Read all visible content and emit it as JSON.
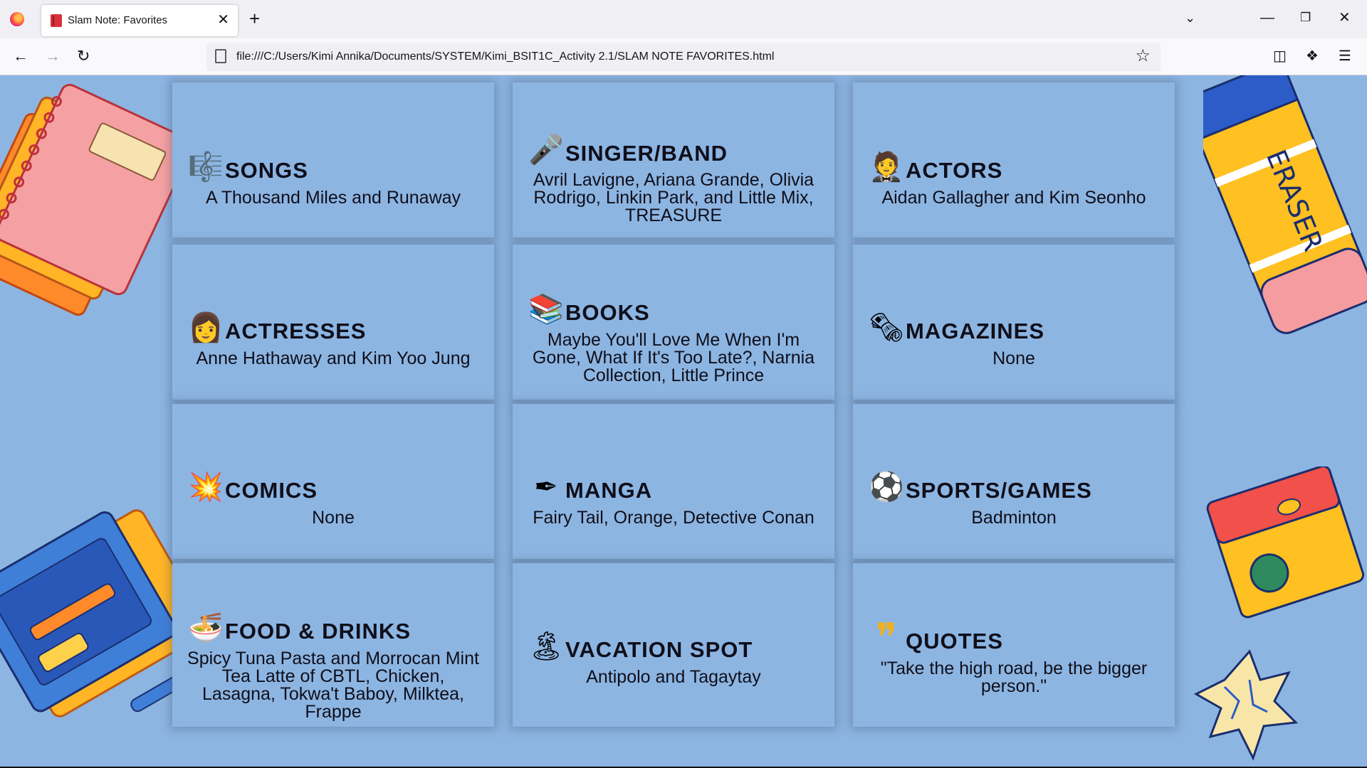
{
  "browser": {
    "tab_title": "Slam Note: Favorites",
    "tab_close": "✕",
    "new_tab": "+",
    "url": "file:///C:/Users/Kimi Annika/Documents/SYSTEM/Kimi_BSIT1C_Activity 2.1/SLAM NOTE FAVORITES.html"
  },
  "cards": [
    {
      "title": "SONGS",
      "body": "A Thousand Miles and Runaway",
      "icon": "music-notes-icon",
      "glyph": "🎼"
    },
    {
      "title": "SINGER/BAND",
      "body": "Avril Lavigne, Ariana Grande, Olivia Rodrigo, Linkin Park, and Little Mix, TREASURE",
      "icon": "microphone-icon",
      "glyph": "🎤"
    },
    {
      "title": "ACTORS",
      "body": "Aidan Gallagher and Kim Seonho",
      "icon": "man-in-suit-icon",
      "glyph": "🤵"
    },
    {
      "title": "ACTRESSES",
      "body": "Anne Hathaway and Kim Yoo Jung",
      "icon": "woman-icon",
      "glyph": "👩"
    },
    {
      "title": "BOOKS",
      "body": "Maybe You'll Love Me When I'm Gone, What If It's Too Late?, Narnia Collection, Little Prince",
      "icon": "books-icon",
      "glyph": "📚"
    },
    {
      "title": "MAGAZINES",
      "body": "None",
      "icon": "newspaper-stack-icon",
      "glyph": "🗞"
    },
    {
      "title": "COMICS",
      "body": "None",
      "icon": "comic-burst-icon",
      "glyph": "💥"
    },
    {
      "title": "MANGA",
      "body": "Fairy Tail, Orange, Detective Conan",
      "icon": "pen-sketch-icon",
      "glyph": "✒"
    },
    {
      "title": "SPORTS/GAMES",
      "body": "Badminton",
      "icon": "sports-ball-icon",
      "glyph": "⚽"
    },
    {
      "title": "FOOD & DRINKS",
      "body": "Spicy Tuna Pasta and Morrocan Mint Tea Latte of CBTL, Chicken, Lasagna, Tokwa't Baboy, Milktea, Frappe",
      "icon": "food-bowl-icon",
      "glyph": "🍜"
    },
    {
      "title": "VACATION SPOT",
      "body": "Antipolo and Tagaytay",
      "icon": "island-icon",
      "glyph": "🏝"
    },
    {
      "title": "QUOTES",
      "body": "\"Take the high road, be the bigger person.\"",
      "icon": "quote-marks-icon",
      "glyph": "❞"
    }
  ]
}
